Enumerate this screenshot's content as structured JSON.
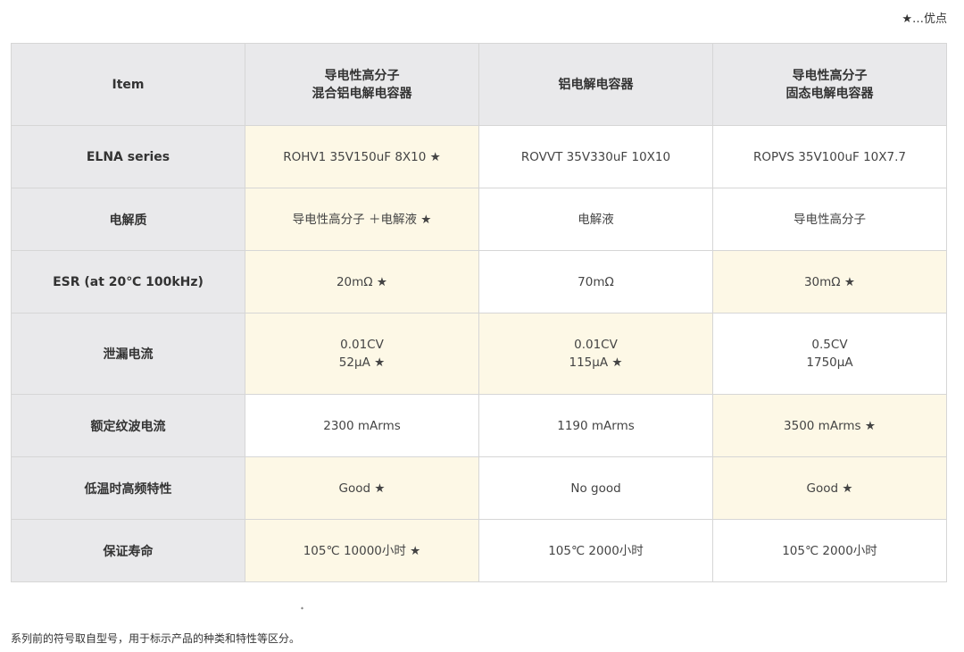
{
  "legend": "★…优点",
  "table": {
    "headers": {
      "item": "Item",
      "col1": [
        "导电性高分子",
        "混合铝电解电容器"
      ],
      "col2": "铝电解电容器",
      "col3": [
        "导电性高分子",
        "固态电解电容器"
      ]
    },
    "rows": [
      {
        "label": "ELNA series",
        "cells": [
          {
            "lines": [
              "ROHV1 35V150uF 8X10 ★"
            ],
            "advantage": true
          },
          {
            "lines": [
              "ROVVT 35V330uF 10X10"
            ],
            "advantage": false
          },
          {
            "lines": [
              "ROPVS 35V100uF 10X7.7"
            ],
            "advantage": false
          }
        ]
      },
      {
        "label": "电解质",
        "cells": [
          {
            "lines": [
              "导电性高分子 ＋电解液 ★"
            ],
            "advantage": true
          },
          {
            "lines": [
              "电解液"
            ],
            "advantage": false
          },
          {
            "lines": [
              "导电性高分子"
            ],
            "advantage": false
          }
        ]
      },
      {
        "label": "ESR (at 20℃ 100kHz)",
        "cells": [
          {
            "lines": [
              "20mΩ ★"
            ],
            "advantage": true
          },
          {
            "lines": [
              "70mΩ"
            ],
            "advantage": false
          },
          {
            "lines": [
              "30mΩ ★"
            ],
            "advantage": true
          }
        ]
      },
      {
        "label": "泄漏电流",
        "cells": [
          {
            "lines": [
              "0.01CV",
              "52μA ★"
            ],
            "advantage": true
          },
          {
            "lines": [
              "0.01CV",
              "115μA ★"
            ],
            "advantage": true
          },
          {
            "lines": [
              "0.5CV",
              "1750μA"
            ],
            "advantage": false
          }
        ]
      },
      {
        "label": "额定纹波电流",
        "cells": [
          {
            "lines": [
              "2300 mArms"
            ],
            "advantage": false
          },
          {
            "lines": [
              "1190 mArms"
            ],
            "advantage": false
          },
          {
            "lines": [
              "3500 mArms ★"
            ],
            "advantage": true
          }
        ]
      },
      {
        "label": "低温时高频特性",
        "cells": [
          {
            "lines": [
              "Good ★"
            ],
            "advantage": true
          },
          {
            "lines": [
              "No good"
            ],
            "advantage": false
          },
          {
            "lines": [
              "Good ★"
            ],
            "advantage": true
          }
        ]
      },
      {
        "label": "保证寿命",
        "cells": [
          {
            "lines": [
              "105℃ 10000小时 ★"
            ],
            "advantage": true
          },
          {
            "lines": [
              "105℃ 2000小时"
            ],
            "advantage": false
          },
          {
            "lines": [
              "105℃ 2000小时"
            ],
            "advantage": false
          }
        ]
      }
    ]
  },
  "footnote_marker": "*",
  "footnote": "系列前的符号取自型号，用于标示产品的种类和特性等区分。",
  "colors": {
    "header_bg": "#e9e9eb",
    "advantage_bg": "#fdf8e6",
    "border": "#d6d6d6",
    "text": "#333333"
  }
}
